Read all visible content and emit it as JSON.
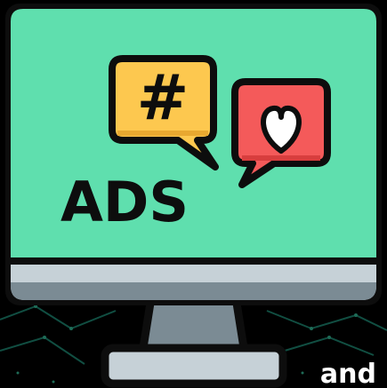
{
  "screen_text": "ADS",
  "bubble_hashtag_symbol": "#",
  "brand_word": "and",
  "icons": [
    "monitor-icon",
    "hashtag-bubble-icon",
    "heart-bubble-icon"
  ],
  "colors": {
    "screen": "#5fdfae",
    "bezel_bottom": "#c6d1d7",
    "bezel_shadow": "#7b8b94",
    "stand": "#7b8b94",
    "outline": "#0d0d0d",
    "bubble_yellow": "#fdc84f",
    "bubble_red": "#f45a5a",
    "heart": "#ffffff",
    "background": "#000000",
    "circuit": "#1f8f78"
  }
}
